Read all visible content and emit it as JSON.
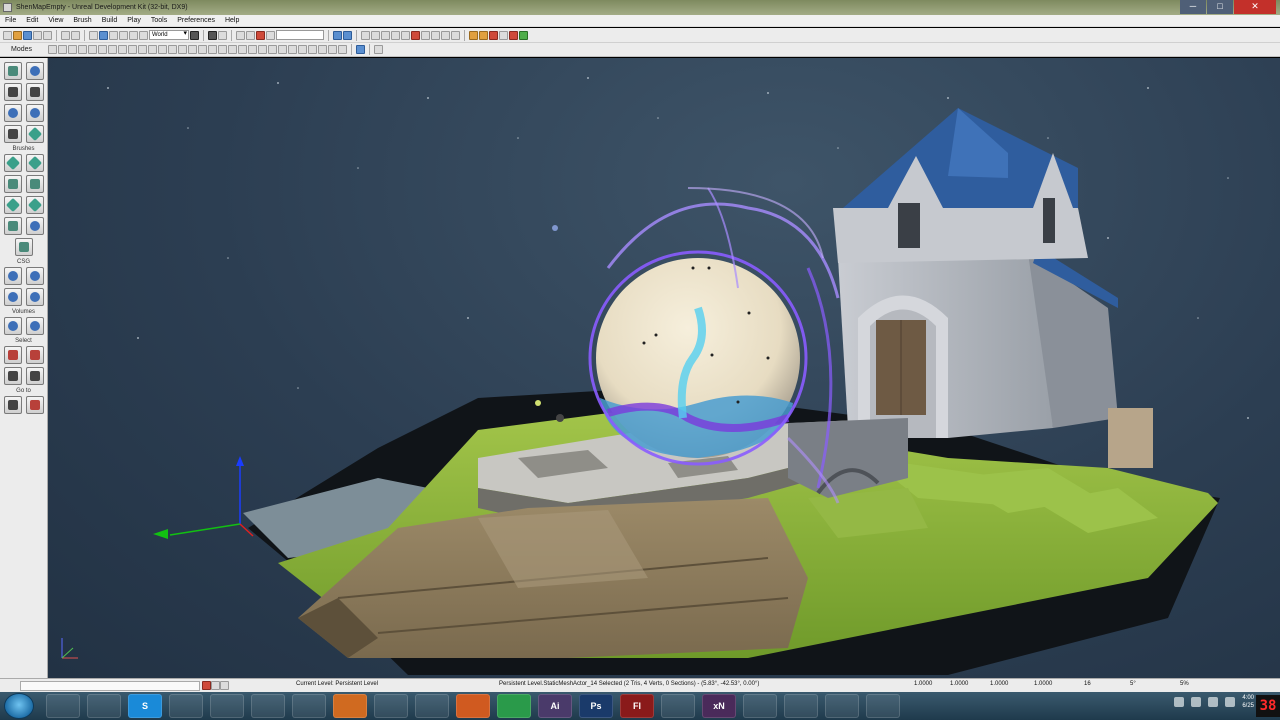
{
  "window": {
    "title": "ShenMapEmpty - Unreal Development Kit (32-bit, DX9)",
    "minimize": "─",
    "maximize": "□",
    "close": "✕"
  },
  "menu": [
    "File",
    "Edit",
    "View",
    "Brush",
    "Build",
    "Play",
    "Tools",
    "Preferences",
    "Help"
  ],
  "toolbar": {
    "world_select": "World",
    "modes_label": "Modes"
  },
  "left_panel": {
    "sections": [
      "Brushes",
      "CSG",
      "Volumes",
      "Select",
      "Go to"
    ]
  },
  "status_bar": {
    "current_level": "Current Level:  Persistent Level",
    "selection_info": "Persistent Level.StaticMeshActor_14 Selected (2 Tris, 4 Verts, 0 Sections) - (5.83°, -42.53°, 0.00°)",
    "grid_a": "1.0000",
    "grid_b": "1.0000",
    "grid_c": "1.0000",
    "grid_d": "1.0000",
    "snap": "16",
    "rot": "5°",
    "scale": "5%"
  },
  "taskbar": {
    "apps": [
      "",
      "",
      "",
      "S",
      "",
      "",
      "",
      "",
      "",
      "",
      "",
      "",
      "",
      "Ai",
      "Ps",
      "Fl",
      "",
      "xN",
      "",
      "",
      "",
      "",
      "",
      "",
      ""
    ],
    "time": "4:00",
    "date": "6/25",
    "rec_counter": "38"
  },
  "colors": {
    "sky": "#2c3e52",
    "grass": "#8ab03a",
    "roof": "#2f5d9e",
    "orb_glow": "#8a5cff"
  }
}
